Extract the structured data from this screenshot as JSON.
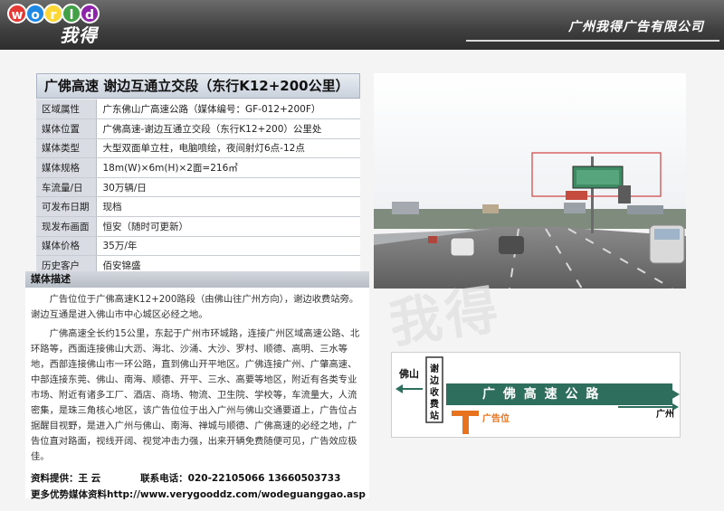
{
  "header": {
    "logo_letters": [
      "w",
      "o",
      "r",
      "l",
      "d"
    ],
    "logo_colors": [
      "#e53935",
      "#1e88e5",
      "#fdd835",
      "#43a047",
      "#8e24aa"
    ],
    "logo_cn": "我得",
    "company": "广州我得广告有限公司"
  },
  "info": {
    "title": "广佛高速 谢边互通立交段（东行K12+200公里）",
    "rows": [
      {
        "k": "区域属性",
        "v": "广东佛山广高速公路（媒体编号：GF-012+200F）"
      },
      {
        "k": "媒体位置",
        "v": "广佛高速-谢边互通立交段（东行K12+200）公里处"
      },
      {
        "k": "媒体类型",
        "v": "大型双面单立柱，电脑喷绘，夜间射灯6点-12点"
      },
      {
        "k": "媒体规格",
        "v": "18m(W)×6m(H)×2面=216㎡"
      },
      {
        "k": "车流量/日",
        "v": "30万辆/日"
      },
      {
        "k": "可发布日期",
        "v": "现档"
      },
      {
        "k": "现发布画面",
        "v": "恒安（随时可更新）"
      },
      {
        "k": "媒体价格",
        "v": "35万/年"
      },
      {
        "k": "历史客户",
        "v": "佰安锦盛"
      }
    ]
  },
  "description": {
    "heading": "媒体描述",
    "paragraphs": [
      "广告位位于广佛高速K12+200路段（由佛山往广州方向），谢边收费站旁。谢边互通是进入佛山市中心城区必经之地。",
      "广佛高速全长约15公里，东起于广州市环城路，连接广州区域高速公路、北环路等，西面连接佛山大沥、海北、沙涌、大沙、罗村、顺德、高明、三水等地，西部连接佛山市一环公路，直到佛山开平地区。广佛连接广州、广肇高速、中部连接东莞、佛山、南海、顺德、开平、三水、高要等地区，附近有各类专业市场、附近有诸多工厂、酒店、商场、物流、卫生院、学校等，车流量大，人流密集，是珠三角核心地区，该广告位位于出入广州与佛山交通要道上，广告位占据醒目视野，是进入广州与佛山、南海、禅城与顺德、广佛高速的必经之地，广告位直对路面，视线开阔、视觉冲击力强，出来开辆免费随便可见，广告效应极佳。"
    ],
    "contact_name_label": "资料提供：王 云",
    "contact_phone_label": "联系电话：020-22105066 13660503733",
    "more": "更多优势媒体资料http://www.verygooddz.com/wodeguanggao.asp"
  },
  "watermark": "我得",
  "map": {
    "left_city": "佛山",
    "station": "谢边收费站",
    "road": "广 佛 高 速 公 路",
    "right_city": "广州",
    "ad_label": "广告位",
    "road_color": "#2e6e5c",
    "ad_color": "#e8731e"
  }
}
